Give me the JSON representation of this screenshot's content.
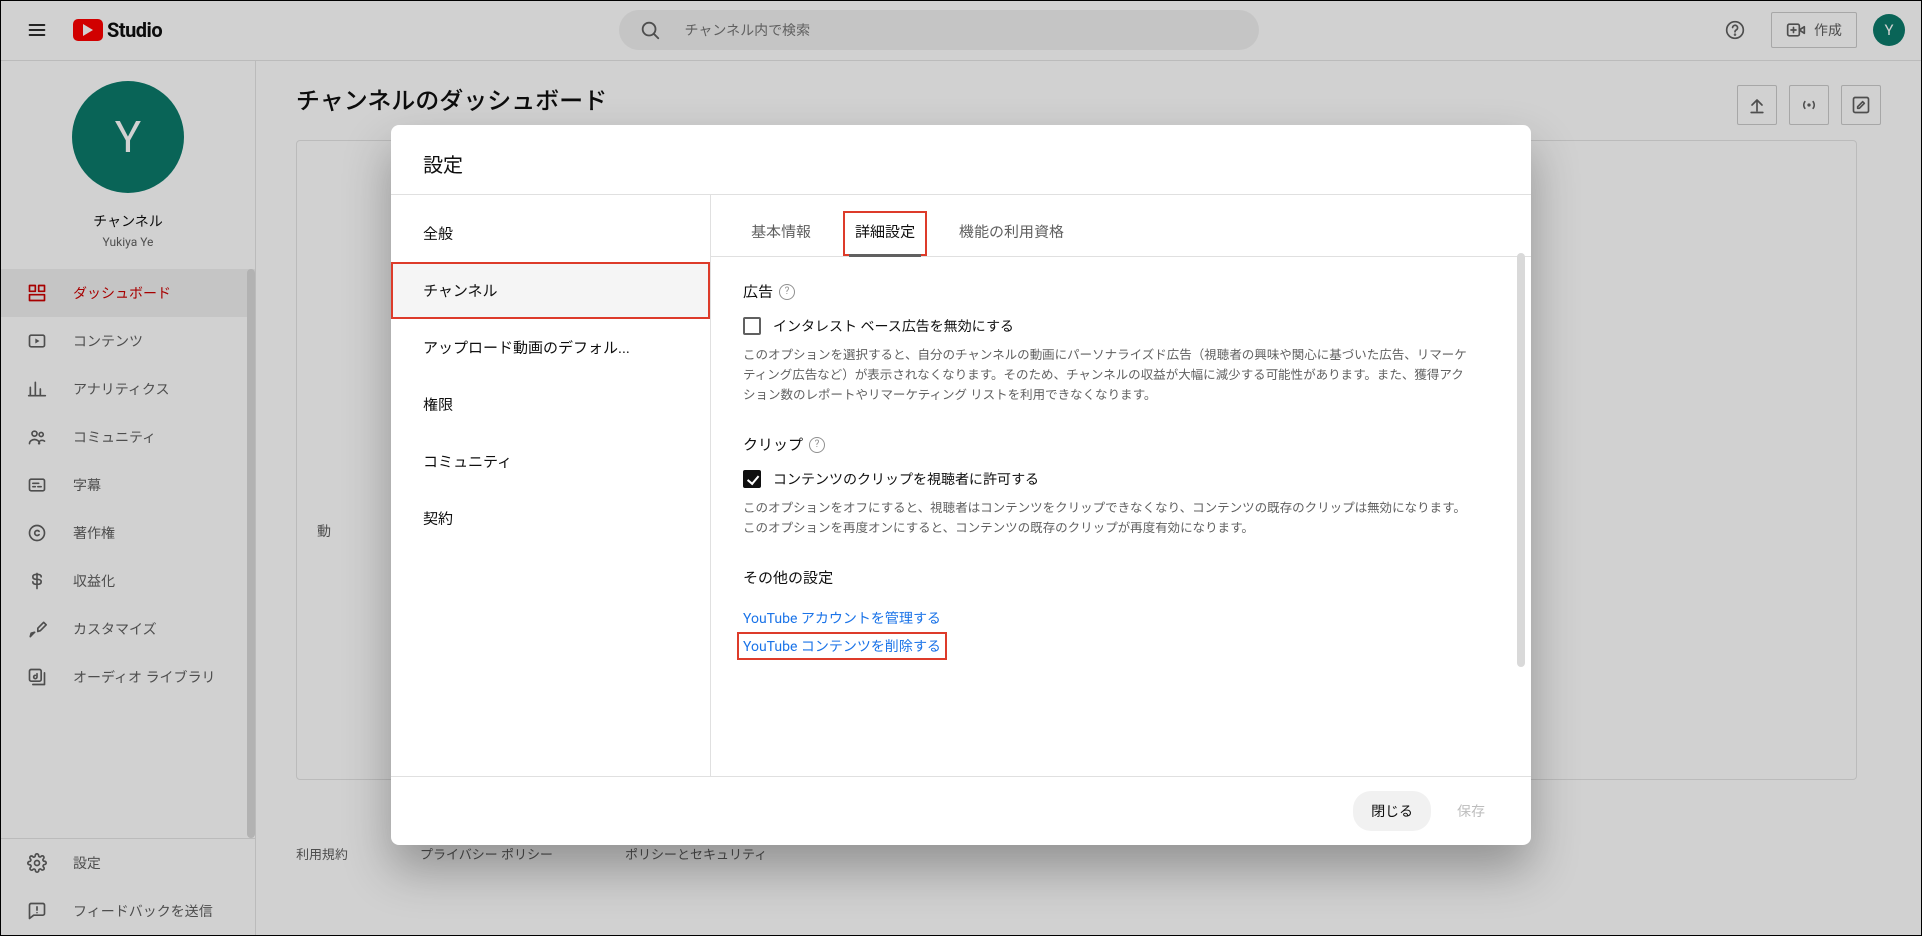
{
  "topbar": {
    "brand": "Studio",
    "search_placeholder": "チャンネル内で検索",
    "create_label": "作成"
  },
  "side": {
    "avatar_letter": "Y",
    "label": "チャンネル",
    "sublabel": "Yukiya Ye",
    "items": [
      {
        "label": "ダッシュボード"
      },
      {
        "label": "コンテンツ"
      },
      {
        "label": "アナリティクス"
      },
      {
        "label": "コミュニティ"
      },
      {
        "label": "字幕"
      },
      {
        "label": "著作権"
      },
      {
        "label": "収益化"
      },
      {
        "label": "カスタマイズ"
      },
      {
        "label": "オーディオ ライブラリ"
      }
    ],
    "bottom": [
      {
        "label": "設定"
      },
      {
        "label": "フィードバックを送信"
      }
    ]
  },
  "page": {
    "title": "チャンネルのダッシュボード",
    "card_trunc_label": "動",
    "footer_links": [
      "利用規約",
      "プライバシー ポリシー",
      "ポリシーとセキュリティ"
    ]
  },
  "dialog": {
    "title": "設定",
    "side_items": [
      {
        "label": "全般"
      },
      {
        "label": "チャンネル",
        "active": true,
        "highlight": true
      },
      {
        "label": "アップロード動画のデフォル...",
        "active": false
      },
      {
        "label": "権限"
      },
      {
        "label": "コミュニティ"
      },
      {
        "label": "契約"
      }
    ],
    "tabs": [
      {
        "label": "基本情報"
      },
      {
        "label": "詳細設定",
        "active": true,
        "highlight": true
      },
      {
        "label": "機能の利用資格"
      }
    ],
    "ads": {
      "title": "広告",
      "checkbox_label": "インタレスト ベース広告を無効にする",
      "desc": "このオプションを選択すると、自分のチャンネルの動画にパーソナライズド広告（視聴者の興味や関心に基づいた広告、リマーケティング広告など）が表示されなくなります。そのため、チャンネルの収益が大幅に減少する可能性があります。また、獲得アクション数のレポートやリマーケティング リストを利用できなくなります。"
    },
    "clips": {
      "title": "クリップ",
      "checkbox_label": "コンテンツのクリップを視聴者に許可する",
      "desc": "このオプションをオフにすると、視聴者はコンテンツをクリップできなくなり、コンテンツの既存のクリップは無効になります。このオプションを再度オンにすると、コンテンツの既存のクリップが再度有効になります。"
    },
    "other": {
      "title": "その他の設定",
      "link_manage": "YouTube アカウントを管理する",
      "link_delete": "YouTube コンテンツを削除する"
    },
    "footer": {
      "close": "閉じる",
      "save": "保存"
    }
  }
}
